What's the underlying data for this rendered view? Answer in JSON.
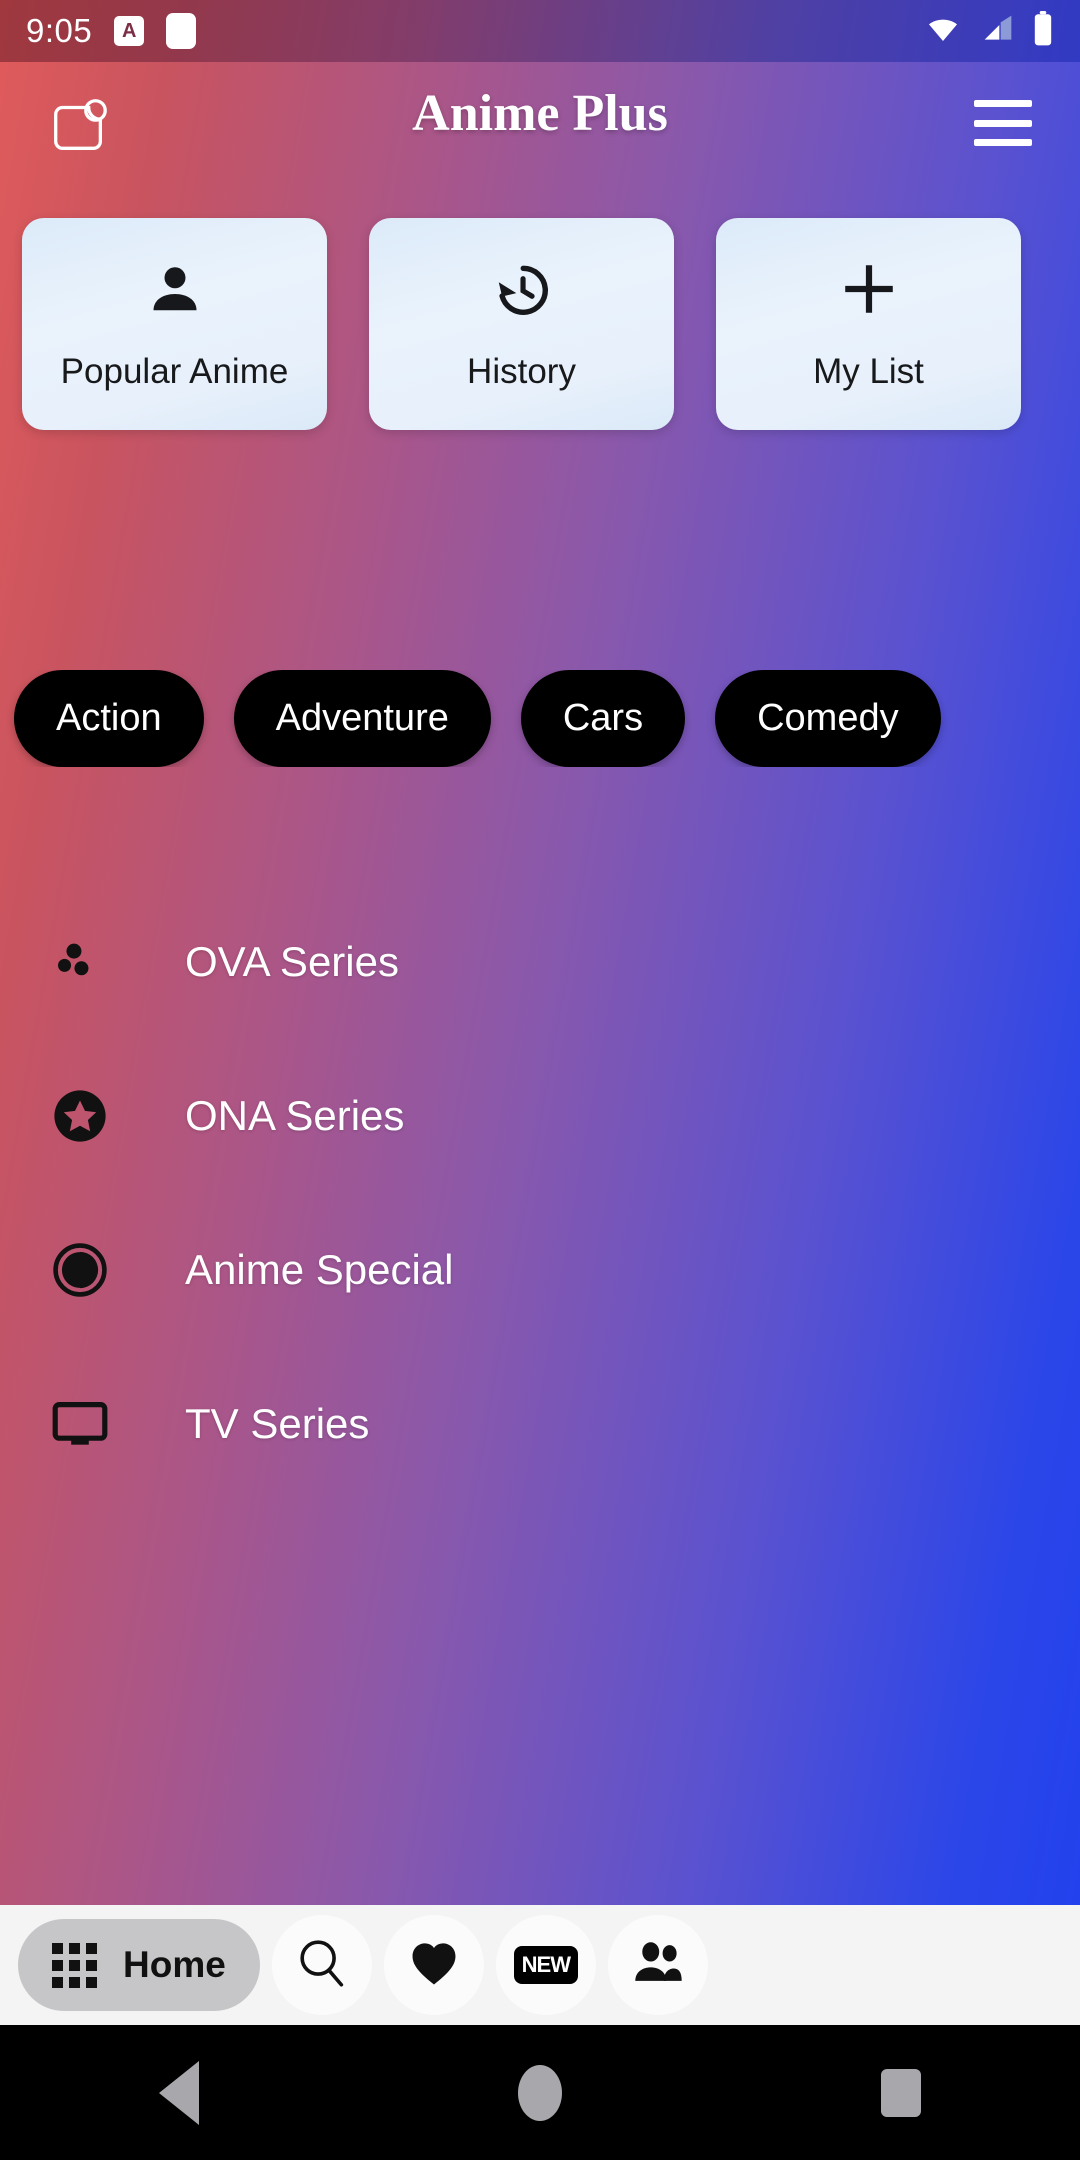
{
  "status_bar": {
    "time": "9:05",
    "icons": [
      "a-badge-icon",
      "notification-square-icon",
      "wifi-icon",
      "cellular-signal-icon",
      "battery-icon"
    ],
    "a_badge_text": "A"
  },
  "app_bar": {
    "title": "Anime Plus",
    "leading_icon": "note-badge-icon",
    "menu_icon": "hamburger-menu-icon"
  },
  "quick_cards": [
    {
      "label": "Popular Anime",
      "icon": "person-icon"
    },
    {
      "label": "History",
      "icon": "history-clock-icon"
    },
    {
      "label": "My List",
      "icon": "plus-icon"
    }
  ],
  "genre_chips": [
    {
      "label": "Action"
    },
    {
      "label": "Adventure"
    },
    {
      "label": "Cars"
    },
    {
      "label": "Comedy"
    }
  ],
  "categories": [
    {
      "label": "OVA Series",
      "icon": "three-dots-scatter-icon"
    },
    {
      "label": "ONA Series",
      "icon": "star-circle-icon"
    },
    {
      "label": "Anime Special",
      "icon": "pie-circle-icon"
    },
    {
      "label": "TV Series",
      "icon": "television-icon"
    }
  ],
  "bottom_nav": {
    "active_label": "Home",
    "active_icon": "grid-icon",
    "items": [
      {
        "icon": "search-icon",
        "label": "Search"
      },
      {
        "icon": "heart-icon",
        "label": "Favorites"
      },
      {
        "icon": "new-badge-icon",
        "label": "NEW"
      },
      {
        "icon": "people-icon",
        "label": "Community"
      }
    ],
    "new_badge_text": "NEW"
  },
  "android_nav": {
    "back": "back-triangle-icon",
    "home": "home-circle-icon",
    "recents": "recents-square-icon"
  },
  "colors": {
    "gradient_start": "#e05b5b",
    "gradient_mid": "#8a58ab",
    "gradient_end": "#2040ef",
    "card_bg": "#e7f0fb",
    "chip_bg": "#000000",
    "nav_bg": "#f4f4f5",
    "nav_active_bg": "#c6c6c8"
  }
}
